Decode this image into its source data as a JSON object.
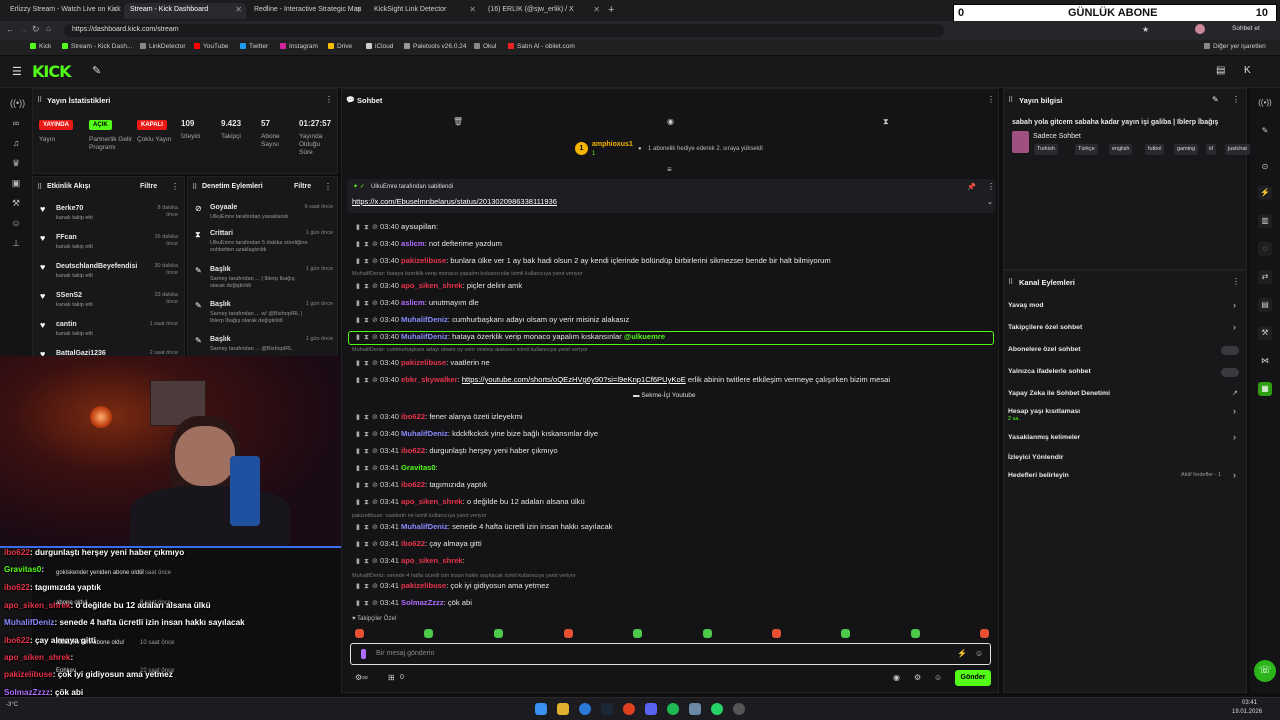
{
  "tabs": [
    {
      "label": "Erlizzy Stream - Watch Live on Kick",
      "active": false
    },
    {
      "label": "Stream - Kick Dashboard",
      "active": true
    },
    {
      "label": "Redline - Interactive Strategic Map",
      "active": false
    },
    {
      "label": "KickSight Link Detector",
      "active": false
    },
    {
      "label": "(16) ERLIK (@sjw_erlik) / X",
      "active": false
    }
  ],
  "abone_counter": {
    "value": "0",
    "label": "GÜNLÜK ABONE",
    "right_value": "10"
  },
  "url": "https://dashboard.kick.com/stream",
  "browser_right": {
    "profile": "Sohbet et",
    "other_bookmarks": "Diğer yer işaretleri"
  },
  "bookmarks": [
    "Kick",
    "Stream - Kick Dash...",
    "LinkDetector",
    "YouTube",
    "Twitter",
    "Instagram",
    "Drive",
    "iCloud",
    "Paletools v26.0.24",
    "Okul",
    "Satın Al - obilet.com"
  ],
  "stats": {
    "title": "Yayın İstatistikleri",
    "items": [
      {
        "badge": "YAYINDA",
        "badge_color": "#e91916",
        "label": "Yayın"
      },
      {
        "badge": "AÇIK",
        "badge_color": "#53fc18",
        "label": "Partnerlik Gelir Programı"
      },
      {
        "badge": "KAPALI",
        "badge_color": "#e91916",
        "label": "Çoklu Yayın"
      },
      {
        "value": "109",
        "label": "İzleyici"
      },
      {
        "value": "9.423",
        "label": "Takipçi"
      },
      {
        "value": "57",
        "label": "Abone Sayısı"
      },
      {
        "value": "01:27:57",
        "label": "Yayında Olduğu Süre"
      }
    ]
  },
  "activity": {
    "title": "Etkinlik Akışı",
    "filter": "Filtre",
    "items": [
      {
        "name": "Berke70",
        "sub": "kanalı takip etti",
        "time": "8 dakika önce"
      },
      {
        "name": "FFcan",
        "sub": "kanalı takip etti",
        "time": "16 dakika önce"
      },
      {
        "name": "DeutschlandBeyefendisi",
        "sub": "kanalı takip etti",
        "time": "30 dakika önce"
      },
      {
        "name": "SSenS2",
        "sub": "kanalı takip etti",
        "time": "33 dakika önce"
      },
      {
        "name": "cantin",
        "sub": "kanalı takip etti",
        "time": "1 saat önce"
      },
      {
        "name": "BattalGazi1236",
        "sub": "",
        "time": "2 saat önce"
      }
    ]
  },
  "moderation": {
    "title": "Denetim Eylemleri",
    "filter": "Filtre",
    "items": [
      {
        "name": "Goyaale",
        "line1": "UlkuEmre tarafından yasaklandı",
        "time": "6 saat önce"
      },
      {
        "name": "Crittari",
        "line1": "UlkuEmre tarafından 5 dakika süreliğine sohbetten uzaklaştırıldı",
        "time": "1 gün önce"
      },
      {
        "name": "Başlık",
        "line1": "Sarney tarafından ... | Iblerp İbağış olarak değiştirildi",
        "time": "1 gün önce"
      },
      {
        "name": "Başlık",
        "line1": "Sarney tarafından ... w/ @BishopIRL | Iblerp İbağış olarak değiştirildi",
        "time": "1 gün önce"
      },
      {
        "name": "Başlık",
        "line1": "Sarney tarafından ... @BishopIRL",
        "time": "1 gün önce"
      }
    ]
  },
  "chat": {
    "title": "Sohbet",
    "top_user": "amphioxus1",
    "top_user_sub": "1",
    "top_event": "1 abonelik hediye ederek 2. sıraya yükseldi",
    "pinned_by": "UlkuEmre tarafından sabitlendi",
    "pinned_link": "https://x.com/Ebuselmnbelarus/status/2013020986338111936",
    "youtube_embed": "Sekme-İçi Youtube",
    "messages": [
      {
        "time": "03:40",
        "user": "aysupilan",
        "color": "#c0c0c0",
        "text": ""
      },
      {
        "time": "03:40",
        "user": "aslicm",
        "color": "#b06cff",
        "text": "not defterime yazdum"
      },
      {
        "time": "03:40",
        "user": "pakizelibuse",
        "color": "#e8344b",
        "text": "bunlara ülke ver 1 ay bak hadi olsun 2 ay kendi içlerinde bölündüp birbirlerini sikmezser bende bir halt bilmiyorum"
      },
      {
        "reply": "MuhalifDeniz: hataya özerklik verip monaco yapalım kıskansınlar isimli kullanıcıya yanıt veriyor"
      },
      {
        "time": "03:40",
        "user": "apo_siken_shrek",
        "color": "#e8344b",
        "text": "piçler delirir amk"
      },
      {
        "time": "03:40",
        "user": "aslicm",
        "color": "#b06cff",
        "text": "unutmayım dle"
      },
      {
        "time": "03:40",
        "user": "MuhalifDeniz",
        "color": "#8a8aff",
        "text": "cumhurbaşkanı adayı olsam oy verir misiniz alakasız"
      },
      {
        "time": "03:40",
        "user": "MuhalifDeniz",
        "color": "#8a8aff",
        "text": "hataya özerklik verip monaco yapalım kıskansınlar",
        "mention": "@ulkuemre"
      },
      {
        "reply": "MuhalifDeniz: cumhurbaşkanı adayı olsam oy verir misiniz alakasız isimli kullanıcıya yanıt veriyor"
      },
      {
        "time": "03:40",
        "user": "pakizelibuse",
        "color": "#e8344b",
        "text": "vaatlerin ne"
      },
      {
        "time": "03:40",
        "user": "ebkr_skywalker",
        "color": "#e8344b",
        "link": "https://youtube.com/shorts/oQEzHVg6y90?si=l9eKnp1Cf6PUyKoE",
        "text": "erlik abinin twitlere etkileşim vermeye çalışırken bizim mesai"
      },
      {
        "time": "03:40",
        "user": "ibo622",
        "color": "#e8344b",
        "text": "fener alanya özeti izleyekmi"
      },
      {
        "time": "03:40",
        "user": "MuhalifDeniz",
        "color": "#8a8aff",
        "text": "kdckfkckck yine bize bağlı kıskansınlar diye"
      },
      {
        "time": "03:41",
        "user": "ibo622",
        "color": "#e8344b",
        "text": "durgunlaştı herşey yeni haber çıkmıyo"
      },
      {
        "time": "03:41",
        "user": "Gravitas0",
        "color": "#53fc18",
        "text": ""
      },
      {
        "time": "03:41",
        "user": "ibo622",
        "color": "#e8344b",
        "text": "tagımızıda yaptık"
      },
      {
        "time": "03:41",
        "user": "apo_siken_shrek",
        "color": "#e8344b",
        "text": "o değilde bu 12 adaları alsana ülkü"
      },
      {
        "reply": "pakizelibuse: vaatlerin ne isimli kullanıcıya yanıt veriyor"
      },
      {
        "time": "03:41",
        "user": "MuhalifDeniz",
        "color": "#8a8aff",
        "text": "senede 4 hafta ücretli izin insan hakkı sayılacak"
      },
      {
        "time": "03:41",
        "user": "ibo622",
        "color": "#e8344b",
        "text": "çay almaya gitti"
      },
      {
        "time": "03:41",
        "user": "apo_siken_shrek",
        "color": "#e8344b",
        "text": ""
      },
      {
        "reply": "MuhalifDeniz: senede 4 hafta ücretli izin insan hakkı sayılacak isimli kullanıcıya yanıt veriyor"
      },
      {
        "time": "03:41",
        "user": "pakizelibuse",
        "color": "#e8344b",
        "text": "çok iyi gidiyosun ama yetmez"
      },
      {
        "time": "03:41",
        "user": "SolmazZzzz",
        "color": "#b06cff",
        "text": "çök abi"
      }
    ],
    "followers_only": "Takipçiler Özel",
    "input_placeholder": "Bir mesaj gönderin",
    "send_label": "Gönder",
    "points": "0"
  },
  "stream_info": {
    "title": "Yayın bilgisi",
    "stream_title": "sabah yola gitcem sabaha kadar yayın işi galiba | Iblerp İbağış",
    "category": "Sadece Sohbet",
    "tags": [
      "Turkish",
      "Türkçe",
      "english",
      "futbol",
      "gaming",
      "irl",
      "justchat"
    ]
  },
  "channel_actions": {
    "title": "Kanal Eylemleri",
    "items": [
      {
        "label": "Yavaş mod",
        "type": "chevron"
      },
      {
        "label": "Takipçilere özel sohbet",
        "type": "chevron"
      },
      {
        "label": "Abonelere özel sohbet",
        "type": "toggle"
      },
      {
        "label": "Yalnızca ifadelerle sohbet",
        "type": "toggle"
      },
      {
        "label": "Yapay Zeka ile Sohbet Denetimi",
        "type": "external"
      },
      {
        "label": "Hesap yaşı kısıtlaması",
        "sub": "2 sa.",
        "type": "chevron"
      },
      {
        "label": "Yasaklanmış kelimeler",
        "type": "chevron"
      },
      {
        "label": "İzleyici Yönlendir",
        "type": "none"
      },
      {
        "label": "Hedefleri belirleyin",
        "extra": "Aktif hedefler - 1",
        "type": "chevron"
      }
    ]
  },
  "overlay_chat": [
    {
      "user": "ibo622",
      "color": "#e8344b",
      "text": ": durgunlaştı herşey yeni haber çıkmıyo"
    },
    {
      "user": "Gravitas0",
      "color": "#53fc18",
      "text": ":"
    },
    {
      "user": "ibo622",
      "color": "#e8344b",
      "text": ": tagımızıda yaptık"
    },
    {
      "user": "apo_siken_shrek",
      "color": "#e8344b",
      "text": ": o değilde bu 12 adaları alsana ülkü"
    },
    {
      "user": "MuhalifDeniz",
      "color": "#8a8aff",
      "text": ": senede 4 hafta ücretli izin insan hakkı sayılacak"
    },
    {
      "user": "ibo622",
      "color": "#e8344b",
      "text": ": çay almaya gitti"
    },
    {
      "user": "apo_siken_shrek",
      "color": "#e8344b",
      "text": ":"
    },
    {
      "user": "pakizelibuse",
      "color": "#e8344b",
      "text": ": çok iyi gidiyosun ama yetmez"
    },
    {
      "user": "SolmazZzzz",
      "color": "#b06cff",
      "text": ": çök abi"
    }
  ],
  "overlay_events": [
    {
      "name": "gokiskender yeniden abone oldu!",
      "time": "5 saat önce"
    },
    {
      "name": "abone oldu!",
      "time": "8 saat önce"
    },
    {
      "name": "AttilaTheTurk abone oldu!",
      "time": "10 saat önce"
    },
    {
      "name": "Eohkev",
      "time": "22 saat önce"
    }
  ],
  "taskbar": {
    "weather": "-3°C",
    "time": "03:41",
    "date": "19.01.2026"
  }
}
